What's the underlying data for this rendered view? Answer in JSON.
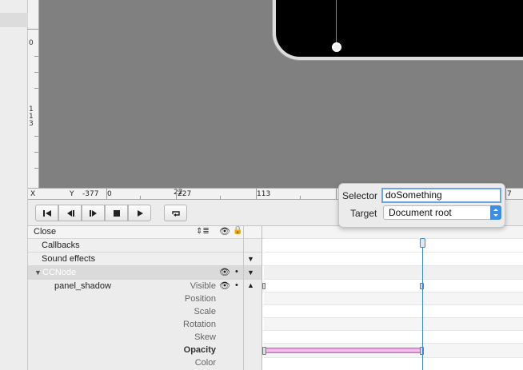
{
  "rulers": {
    "vertical_labels": [
      "0",
      "1",
      "1",
      "3"
    ],
    "horizontal": {
      "x_label": "X",
      "y_label": "Y",
      "y_value": "-377",
      "labels": [
        "0",
        "22",
        "227",
        "113",
        "7"
      ]
    }
  },
  "transport": {
    "buttons": [
      "skip-to-start-icon",
      "step-back-icon",
      "step-forward-icon",
      "stop-icon",
      "play-icon",
      "loop-icon"
    ]
  },
  "timeline": {
    "header": {
      "sequence_name": "Close",
      "time_start": "0"
    },
    "rows": {
      "callbacks": "Callbacks",
      "sound_effects": "Sound effects",
      "node_type": "CCNode",
      "node_name": "panel_shadow"
    },
    "properties": [
      "Visible",
      "Position",
      "Scale",
      "Rotation",
      "Skew",
      "Opacity",
      "Color"
    ],
    "tween_color": "#e79be0"
  },
  "popover": {
    "selector_label": "Selector",
    "selector_value": "doSomething",
    "target_label": "Target",
    "target_value": "Document root"
  },
  "colors": {
    "canvas": "#808080",
    "accent": "#3d87d8",
    "node_row": "#dadada"
  }
}
